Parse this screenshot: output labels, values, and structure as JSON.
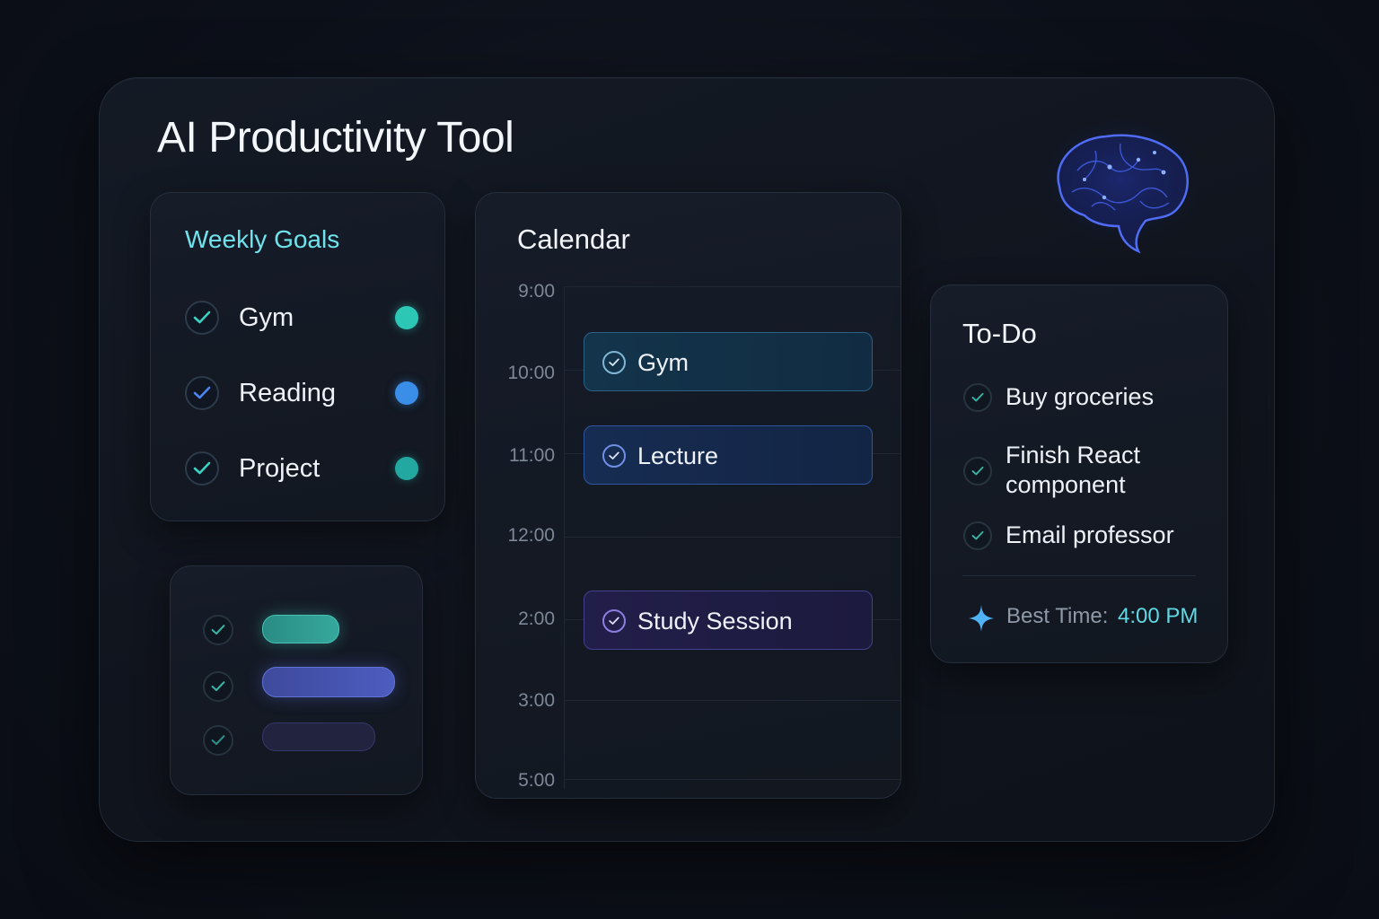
{
  "app": {
    "title": "AI Productivity Tool"
  },
  "weekly_goals": {
    "title": "Weekly Goals",
    "items": [
      {
        "label": "Gym",
        "dot_color": "#2cc7b5",
        "check_color": "#3ad1c0"
      },
      {
        "label": "Reading",
        "dot_color": "#3b8ee8",
        "check_color": "#4a84f0"
      },
      {
        "label": "Project",
        "dot_color": "#22a8a0",
        "check_color": "#3ad1c0"
      }
    ]
  },
  "mini_card": {
    "bar_colors": [
      "#2e9c92",
      "#4a5bb8",
      "#2a2c52"
    ]
  },
  "calendar": {
    "title": "Calendar",
    "times": [
      "9:00",
      "10:00",
      "11:00",
      "12:00",
      "2:00",
      "3:00",
      "5:00"
    ],
    "events": [
      {
        "label": "Gym",
        "bg": "#12324a",
        "border": "#2a5d80",
        "icon": "check-icon"
      },
      {
        "label": "Lecture",
        "bg": "#15284a",
        "border": "#2f4f93",
        "icon": "check-icon"
      },
      {
        "label": "Study Session",
        "bg": "#1e1c42",
        "border": "#3d3a85",
        "icon": "check-icon"
      }
    ]
  },
  "todo": {
    "title": "To-Do",
    "items": [
      {
        "label": "Buy groceries"
      },
      {
        "label": "Finish React component"
      },
      {
        "label": "Email professor"
      }
    ],
    "best_time_label": "Best Time:",
    "best_time_value": "4:00 PM"
  },
  "colors": {
    "accent_cyan": "#6fe3ec",
    "accent_blue": "#3b6cf0",
    "background": "#0c1019"
  }
}
